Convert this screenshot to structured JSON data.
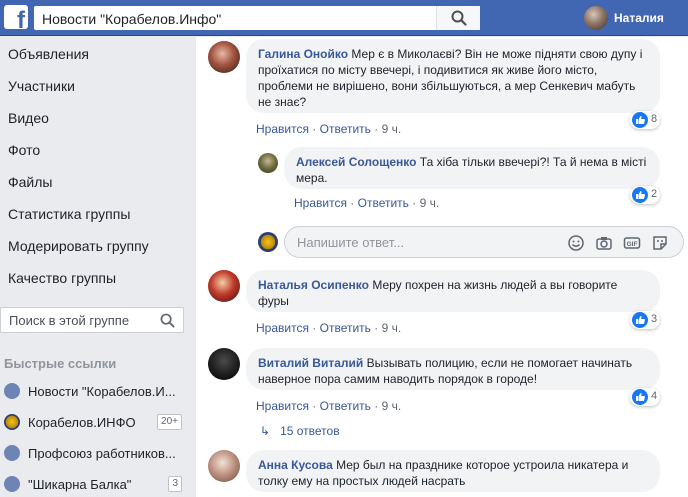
{
  "header": {
    "search_value": "Новости \"Корабелов.Инфо\"",
    "user_name": "Наталия"
  },
  "sidebar": {
    "items": [
      "Объявления",
      "Участники",
      "Видео",
      "Фото",
      "Файлы",
      "Статистика группы",
      "Модерировать группу",
      "Качество группы"
    ],
    "search_placeholder": "Поиск в этой группе",
    "quick_links_title": "Быстрые ссылки",
    "quick_links": [
      {
        "label": "Новости \"Корабелов.И...",
        "badge": ""
      },
      {
        "label": "Корабелов.ИНФО",
        "badge": "20+"
      },
      {
        "label": "Профсоюз работников...",
        "badge": ""
      },
      {
        "label": "\"Шикарна Балка\"",
        "badge": "3"
      }
    ]
  },
  "comments": [
    {
      "author": "Галина Онойко",
      "text": "Мер є в Миколаєві? Він не може підняти свою дупу і проїхатися по місту ввечері, і подивитися як живе його місто, проблеми не вирішено, вони збільшуються, а мер Сенкевич мабуть не знає?",
      "like": "Нравится",
      "reply": "Ответить",
      "time": "9 ч.",
      "reactions": "8"
    },
    {
      "author": "Алексей Солощенко",
      "text": "Та хіба тільки ввечері?! Та й нема в місті мера.",
      "like": "Нравится",
      "reply": "Ответить",
      "time": "9 ч.",
      "reactions": "2"
    },
    {
      "author": "Наталья Осипенко",
      "text": "Меру похрен на жизнь людей а вы говорите фуры",
      "like": "Нравится",
      "reply": "Ответить",
      "time": "9 ч.",
      "reactions": "3"
    },
    {
      "author": "Виталий Виталий",
      "text": "Вызывать полицию, если не помогает начинать наверное пора самим наводить порядок в городе!",
      "like": "Нравится",
      "reply": "Ответить",
      "time": "9 ч.",
      "reactions": "4"
    },
    {
      "author": "Анна Кусова",
      "text": "Мер был на празднике которое устроила никатера и толку ему на простых людей насрать",
      "like": "",
      "reply": "",
      "time": "",
      "reactions": ""
    }
  ],
  "reply_input": {
    "placeholder": "Напишите ответ..."
  },
  "replies_link": "15 ответов",
  "separator": " · ",
  "icons": {
    "logo": "facebook-logo",
    "search": "search-icon",
    "smiley": "smiley-icon",
    "camera": "camera-icon",
    "gif": "gif-icon",
    "sticker": "sticker-icon",
    "like": "thumbs-up-icon",
    "group": "group-icon",
    "reply_arrow": "reply-arrow-icon"
  },
  "colors": {
    "brand": "#4267b2",
    "link": "#385898",
    "bubble": "#f2f3f5",
    "like": "#1877f2"
  }
}
